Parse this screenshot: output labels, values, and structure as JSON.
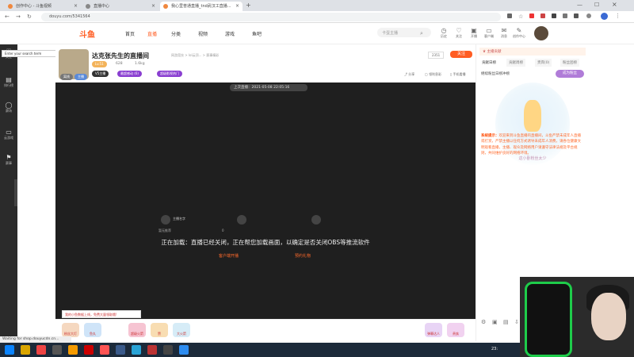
{
  "browser": {
    "tabs": [
      {
        "label": "创作中心 - 斗鱼视频"
      },
      {
        "label": "直播中心"
      },
      {
        "label": "我心里普通直播_tnd武汉工直播..."
      }
    ],
    "new_tab": "+",
    "url": "douyu.com/5341564",
    "status": "Waiting for shop.douyucdn.cn..."
  },
  "header": {
    "logo": "斗鱼",
    "nav": [
      {
        "label": "首页"
      },
      {
        "label": "直播"
      },
      {
        "label": "分类"
      },
      {
        "label": "视频"
      },
      {
        "label": "游戏"
      },
      {
        "label": "鱼吧"
      }
    ],
    "search_placeholder": "卡蛋主播",
    "icons": [
      {
        "label": "历史",
        "icon": "history-icon"
      },
      {
        "label": "关注",
        "icon": "follow-icon"
      },
      {
        "label": "开播",
        "icon": "live-icon"
      },
      {
        "label": "客户端",
        "icon": "client-icon"
      },
      {
        "label": "消息",
        "icon": "message-icon"
      },
      {
        "label": "创作中心",
        "icon": "creator-icon"
      }
    ]
  },
  "sidebar": {
    "items": [
      {
        "label": "关注",
        "icon": "heart-icon"
      },
      {
        "label": "排行榜",
        "icon": "rank-icon"
      },
      {
        "label": "赛场",
        "icon": "match-icon"
      },
      {
        "label": "云游戏",
        "icon": "cloud-game-icon"
      },
      {
        "label": "赛事",
        "icon": "event-icon"
      }
    ],
    "tooltip": "Enter your search term"
  },
  "room": {
    "title": "达克张先生的直播间",
    "crumb": "网游竞技 > lol云顶... > 赛事精彩",
    "status_tag": "离线",
    "level": "Lv.51",
    "anchor_level": "主播",
    "room_number": "2351",
    "follow": "关注",
    "hot": "628",
    "fans": "1.6kg",
    "badges": [
      {
        "label": "V5主播"
      },
      {
        "label": "最超感动 (6)"
      },
      {
        "label": "超级影视热门"
      }
    ],
    "tools": [
      {
        "label": "分享"
      },
      {
        "label": "领利息彩"
      },
      {
        "label": "手机看播"
      }
    ]
  },
  "player": {
    "last_live": "上次直播：2021-05-08 22:05:16",
    "thumbs": [
      {
        "name": "主播名字",
        "sub": "暂无推荐",
        "count": "0"
      },
      {
        "name": "",
        "sub": "",
        "count": ""
      },
      {
        "name": "",
        "sub": "",
        "count": ""
      }
    ],
    "loading_msg": "正在加载：直播已经关闭，正在帮您加载画面，以确定是否关闭OBS等推流软件",
    "links": [
      {
        "label": "客户端开播"
      },
      {
        "label": "预约礼物"
      }
    ]
  },
  "giftbar": {
    "tip": "我的小鱼数据上线，免费大量领取哦!",
    "gifts": [
      {
        "label": "粉丝大灯"
      },
      {
        "label": "鱼丸"
      },
      {
        "label": "超级火箭"
      },
      {
        "label": "赞"
      },
      {
        "label": "大火箭"
      },
      {
        "label": "弹幕达人"
      },
      {
        "label": "贵族"
      }
    ]
  },
  "rightpanel": {
    "header": "主播贡献",
    "tabs": [
      {
        "label": "贡献日榜"
      },
      {
        "label": "贡献周榜"
      },
      {
        "label": "贵宾(0)"
      },
      {
        "label": "粉丝团榜"
      }
    ],
    "rank_text": "继续粉丝日榜冲榜",
    "rank_btn": "成为粉丝",
    "mascot_caption": "这小卧粉丝太少",
    "sys_label": "系统提示：",
    "sys_msg": "欢迎来到斗鱼直播的直播间，斗鱼严禁未成年人直播或打赏，严禁主播以任何方式诱导未成年人消费，请各位健康文明观看直播，主播、观众及网络用户请遵守法律法规及平台规则，共同维护良好的网络环境。",
    "icons": [
      {
        "icon": "gear-icon"
      },
      {
        "icon": "image-icon"
      },
      {
        "icon": "filter-icon"
      },
      {
        "icon": "download-icon"
      }
    ]
  },
  "taskbar": {
    "time": "23:"
  },
  "colors": {
    "accent": "#ff5d23",
    "player_bg": "#1f1f1f",
    "sidebar_bg": "#2b2b2b",
    "webcam_chair": "#1ecc4a"
  }
}
